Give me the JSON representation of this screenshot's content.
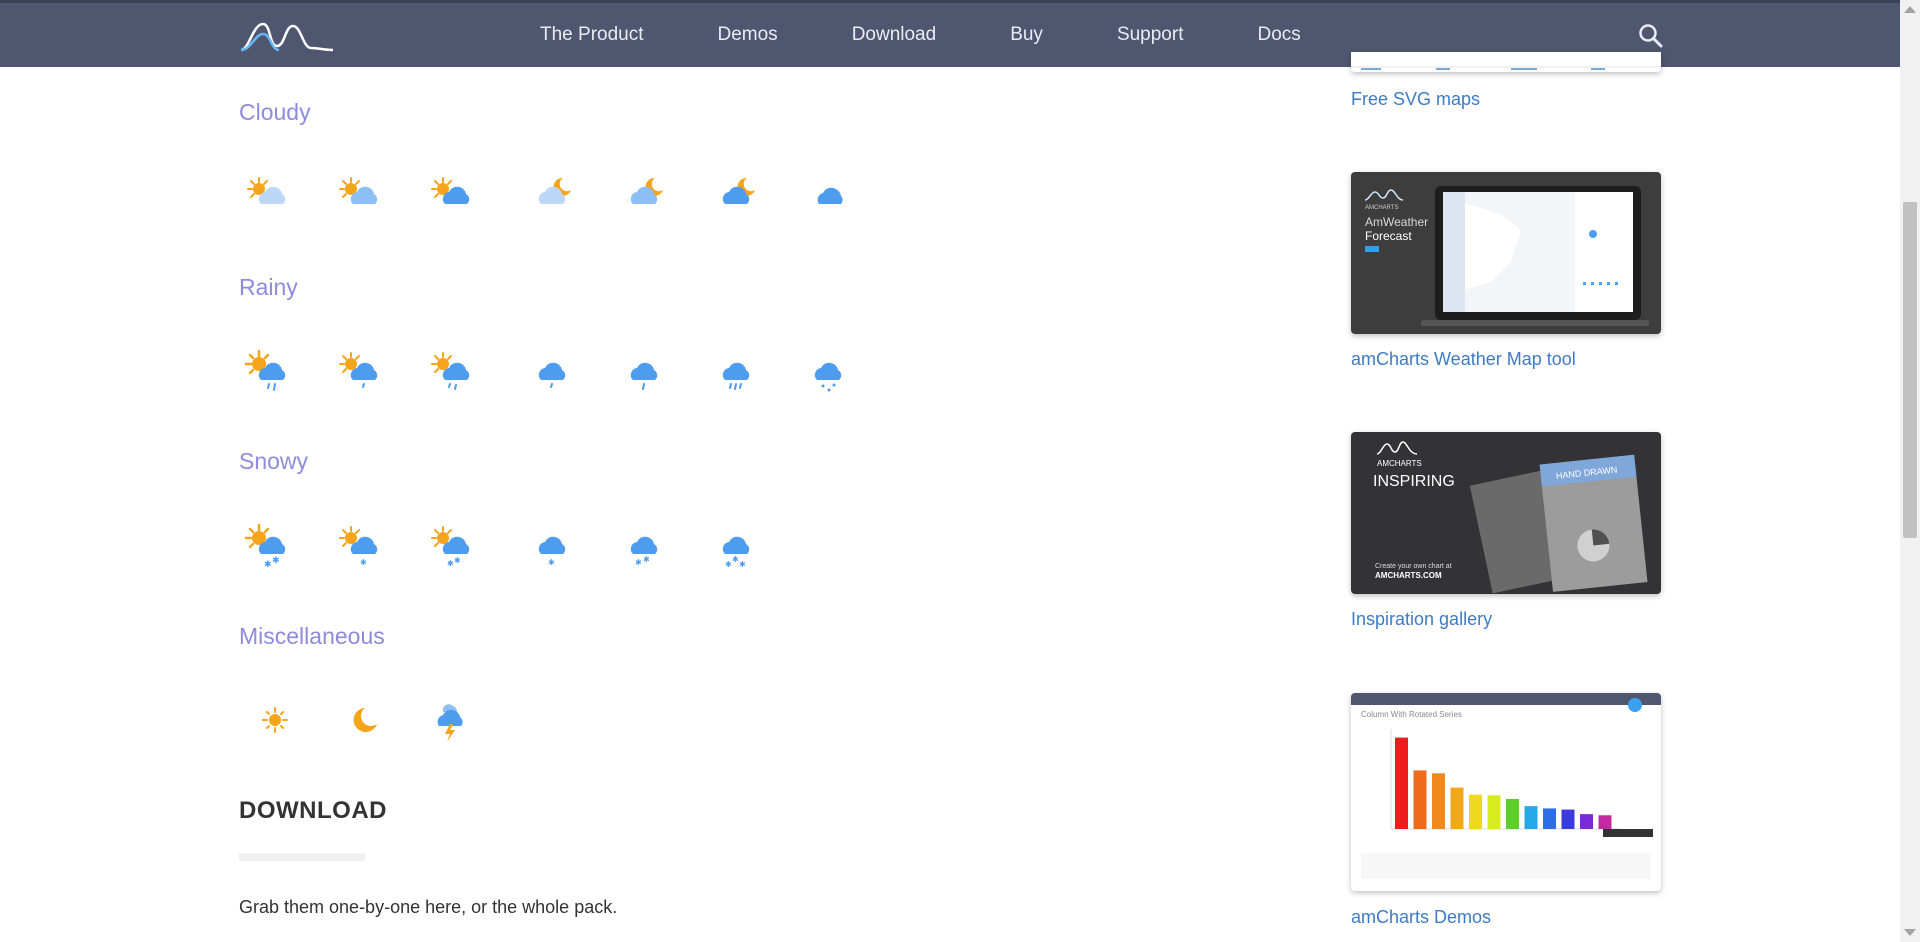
{
  "nav": {
    "items": [
      "The Product",
      "Demos",
      "Download",
      "Buy",
      "Support",
      "Docs"
    ],
    "logo_icon": "amcharts-logo",
    "search_icon": "search-icon"
  },
  "sections": [
    {
      "title": "Cloudy",
      "icons": [
        "day-cloudy-light",
        "day-cloudy-medium",
        "day-cloudy-heavy",
        "night-cloudy-light",
        "night-cloudy-medium",
        "night-cloudy-heavy",
        "overcast"
      ]
    },
    {
      "title": "Rainy",
      "icons": [
        "day-rain-1",
        "day-rain-2",
        "day-rain-3",
        "rain-1",
        "rain-2",
        "rain-3",
        "rain-drops"
      ]
    },
    {
      "title": "Snowy",
      "icons": [
        "day-snow-1",
        "day-snow-2",
        "day-snow-3",
        "snow-1",
        "snow-2",
        "snow-3"
      ]
    },
    {
      "title": "Miscellaneous",
      "icons": [
        "sun",
        "moon",
        "thunderstorm"
      ]
    }
  ],
  "download": {
    "title": "DOWNLOAD",
    "text": "Grab them one-by-one here, or the whole pack."
  },
  "sidebar": {
    "links": [
      "Free SVG maps",
      "amCharts Weather Map tool",
      "Inspiration gallery",
      "amCharts Demos"
    ],
    "weather_promo": {
      "brand": "AMCHARTS",
      "line1": "AmWeather",
      "line2": "Forecast"
    },
    "inspiring_promo": {
      "brand": "AMCHARTS",
      "title": "INSPIRING",
      "badge": "HAND DRAWN",
      "footer1": "Create your own chart at",
      "footer2": "AMCHARTS.COM"
    },
    "demo_promo": {
      "title": "Column With Rotated Series",
      "bars": [
        3200,
        2050,
        1950,
        1450,
        1200,
        1180,
        1050,
        800,
        720,
        680,
        520,
        480
      ]
    }
  },
  "colors": {
    "nav_bg": "#4f5670",
    "section_title": "#8e8bdc",
    "link": "#3e7bc4",
    "sun": "#f6a41a",
    "cloud_blue": "#4d9cf0",
    "cloud_light": "#bcd8f7"
  }
}
